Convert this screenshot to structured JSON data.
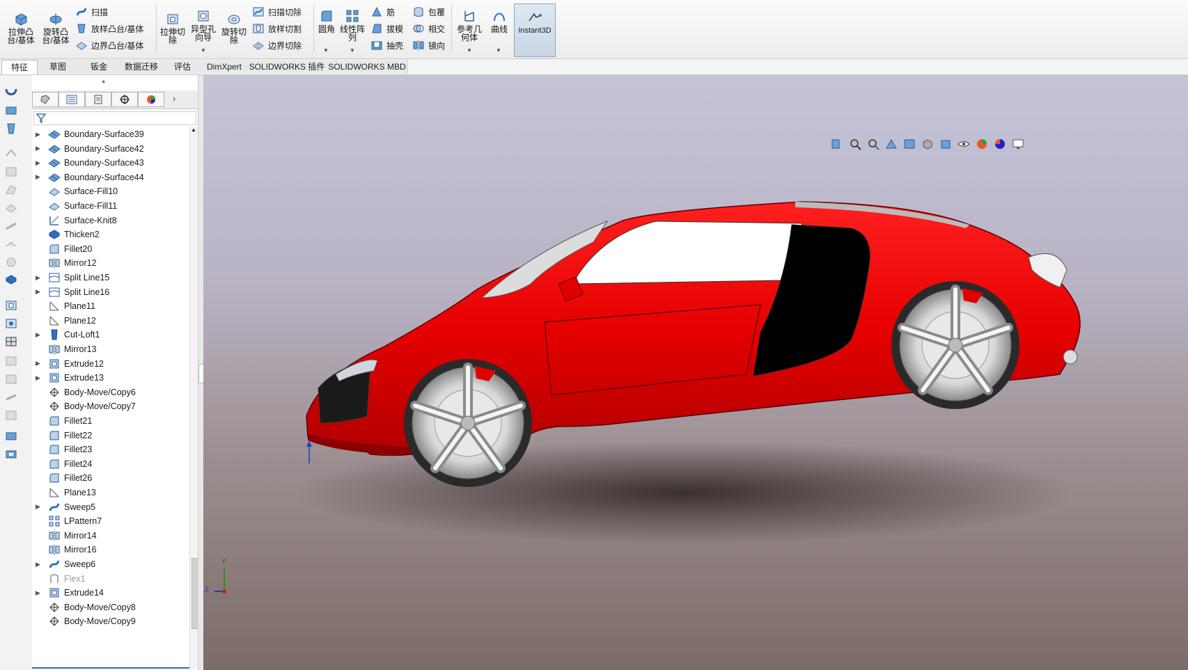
{
  "ribbon": {
    "big": [
      {
        "id": "extrude-boss",
        "label": "拉伸凸\n台/基体"
      },
      {
        "id": "revolve-boss",
        "label": "旋转凸\n台/基体"
      },
      {
        "id": "extrude-cut",
        "label": "拉伸切\n除"
      },
      {
        "id": "hole-wizard",
        "label": "异型孔\n向导"
      },
      {
        "id": "revolve-cut",
        "label": "旋转切\n除"
      },
      {
        "id": "fillet",
        "label": "圆角"
      },
      {
        "id": "linear-pattern",
        "label": "线性阵\n列"
      },
      {
        "id": "ref-geometry",
        "label": "参考几\n何体"
      },
      {
        "id": "curves",
        "label": "曲线"
      }
    ],
    "small": {
      "sweep": "扫描",
      "loft": "放样凸台/基体",
      "boundary": "边界凸台/基体",
      "sweep_cut": "扫描切除",
      "loft_cut": "放样切割",
      "boundary_cut": "边界切除",
      "rib": "筋",
      "draft": "拔模",
      "shell": "抽壳",
      "wrap": "包覆",
      "intersect": "相交",
      "mirror": "镜向"
    },
    "instant3d": "Instant3D"
  },
  "tabs": [
    "特征",
    "草图",
    "钣金",
    "数据迁移",
    "评估",
    "DimXpert",
    "SOLIDWORKS 插件",
    "SOLIDWORKS MBD"
  ],
  "tree": [
    {
      "label": "Boundary-Surface39",
      "icon": "boundary-surface-icon",
      "exp": true
    },
    {
      "label": "Boundary-Surface42",
      "icon": "boundary-surface-icon",
      "exp": true
    },
    {
      "label": "Boundary-Surface43",
      "icon": "boundary-surface-icon",
      "exp": true
    },
    {
      "label": "Boundary-Surface44",
      "icon": "boundary-surface-icon",
      "exp": true
    },
    {
      "label": "Surface-Fill10",
      "icon": "surface-fill-icon",
      "exp": false
    },
    {
      "label": "Surface-Fill11",
      "icon": "surface-fill-icon",
      "exp": false
    },
    {
      "label": "Surface-Knit8",
      "icon": "surface-knit-icon",
      "exp": false
    },
    {
      "label": "Thicken2",
      "icon": "thicken-icon",
      "exp": false
    },
    {
      "label": "Fillet20",
      "icon": "fillet-icon",
      "exp": false
    },
    {
      "label": "Mirror12",
      "icon": "mirror-icon",
      "exp": false
    },
    {
      "label": "Split Line15",
      "icon": "split-line-icon",
      "exp": true
    },
    {
      "label": "Split Line16",
      "icon": "split-line-icon",
      "exp": true
    },
    {
      "label": "Plane11",
      "icon": "plane-icon",
      "exp": false
    },
    {
      "label": "Plane12",
      "icon": "plane-icon",
      "exp": false
    },
    {
      "label": "Cut-Loft1",
      "icon": "cut-loft-icon",
      "exp": true
    },
    {
      "label": "Mirror13",
      "icon": "mirror-icon",
      "exp": false
    },
    {
      "label": "Extrude12",
      "icon": "extrude-icon",
      "exp": true
    },
    {
      "label": "Extrude13",
      "icon": "extrude-icon",
      "exp": true
    },
    {
      "label": "Body-Move/Copy6",
      "icon": "body-move-icon",
      "exp": false
    },
    {
      "label": "Body-Move/Copy7",
      "icon": "body-move-icon",
      "exp": false
    },
    {
      "label": "Fillet21",
      "icon": "fillet-icon",
      "exp": false
    },
    {
      "label": "Fillet22",
      "icon": "fillet-icon",
      "exp": false
    },
    {
      "label": "Fillet23",
      "icon": "fillet-icon",
      "exp": false
    },
    {
      "label": "Fillet24",
      "icon": "fillet-icon",
      "exp": false
    },
    {
      "label": "Fillet26",
      "icon": "fillet-icon",
      "exp": false
    },
    {
      "label": "Plane13",
      "icon": "plane-icon",
      "exp": false
    },
    {
      "label": "Sweep5",
      "icon": "sweep-icon",
      "exp": true
    },
    {
      "label": "LPattern7",
      "icon": "linear-pattern-icon",
      "exp": false
    },
    {
      "label": "Mirror14",
      "icon": "mirror-icon",
      "exp": false
    },
    {
      "label": "Mirror16",
      "icon": "mirror-icon",
      "exp": false
    },
    {
      "label": "Sweep6",
      "icon": "sweep-icon",
      "exp": true
    },
    {
      "label": "Flex1",
      "icon": "flex-icon",
      "exp": false,
      "dim": true
    },
    {
      "label": "Extrude14",
      "icon": "extrude-icon",
      "exp": true
    },
    {
      "label": "Body-Move/Copy8",
      "icon": "body-move-icon",
      "exp": false
    },
    {
      "label": "Body-Move/Copy9",
      "icon": "body-move-icon",
      "exp": false
    }
  ],
  "colors": {
    "car_red": "#e00000",
    "accent": "#2a6bb8"
  },
  "triad": {
    "y": "Y",
    "z": "Z"
  }
}
